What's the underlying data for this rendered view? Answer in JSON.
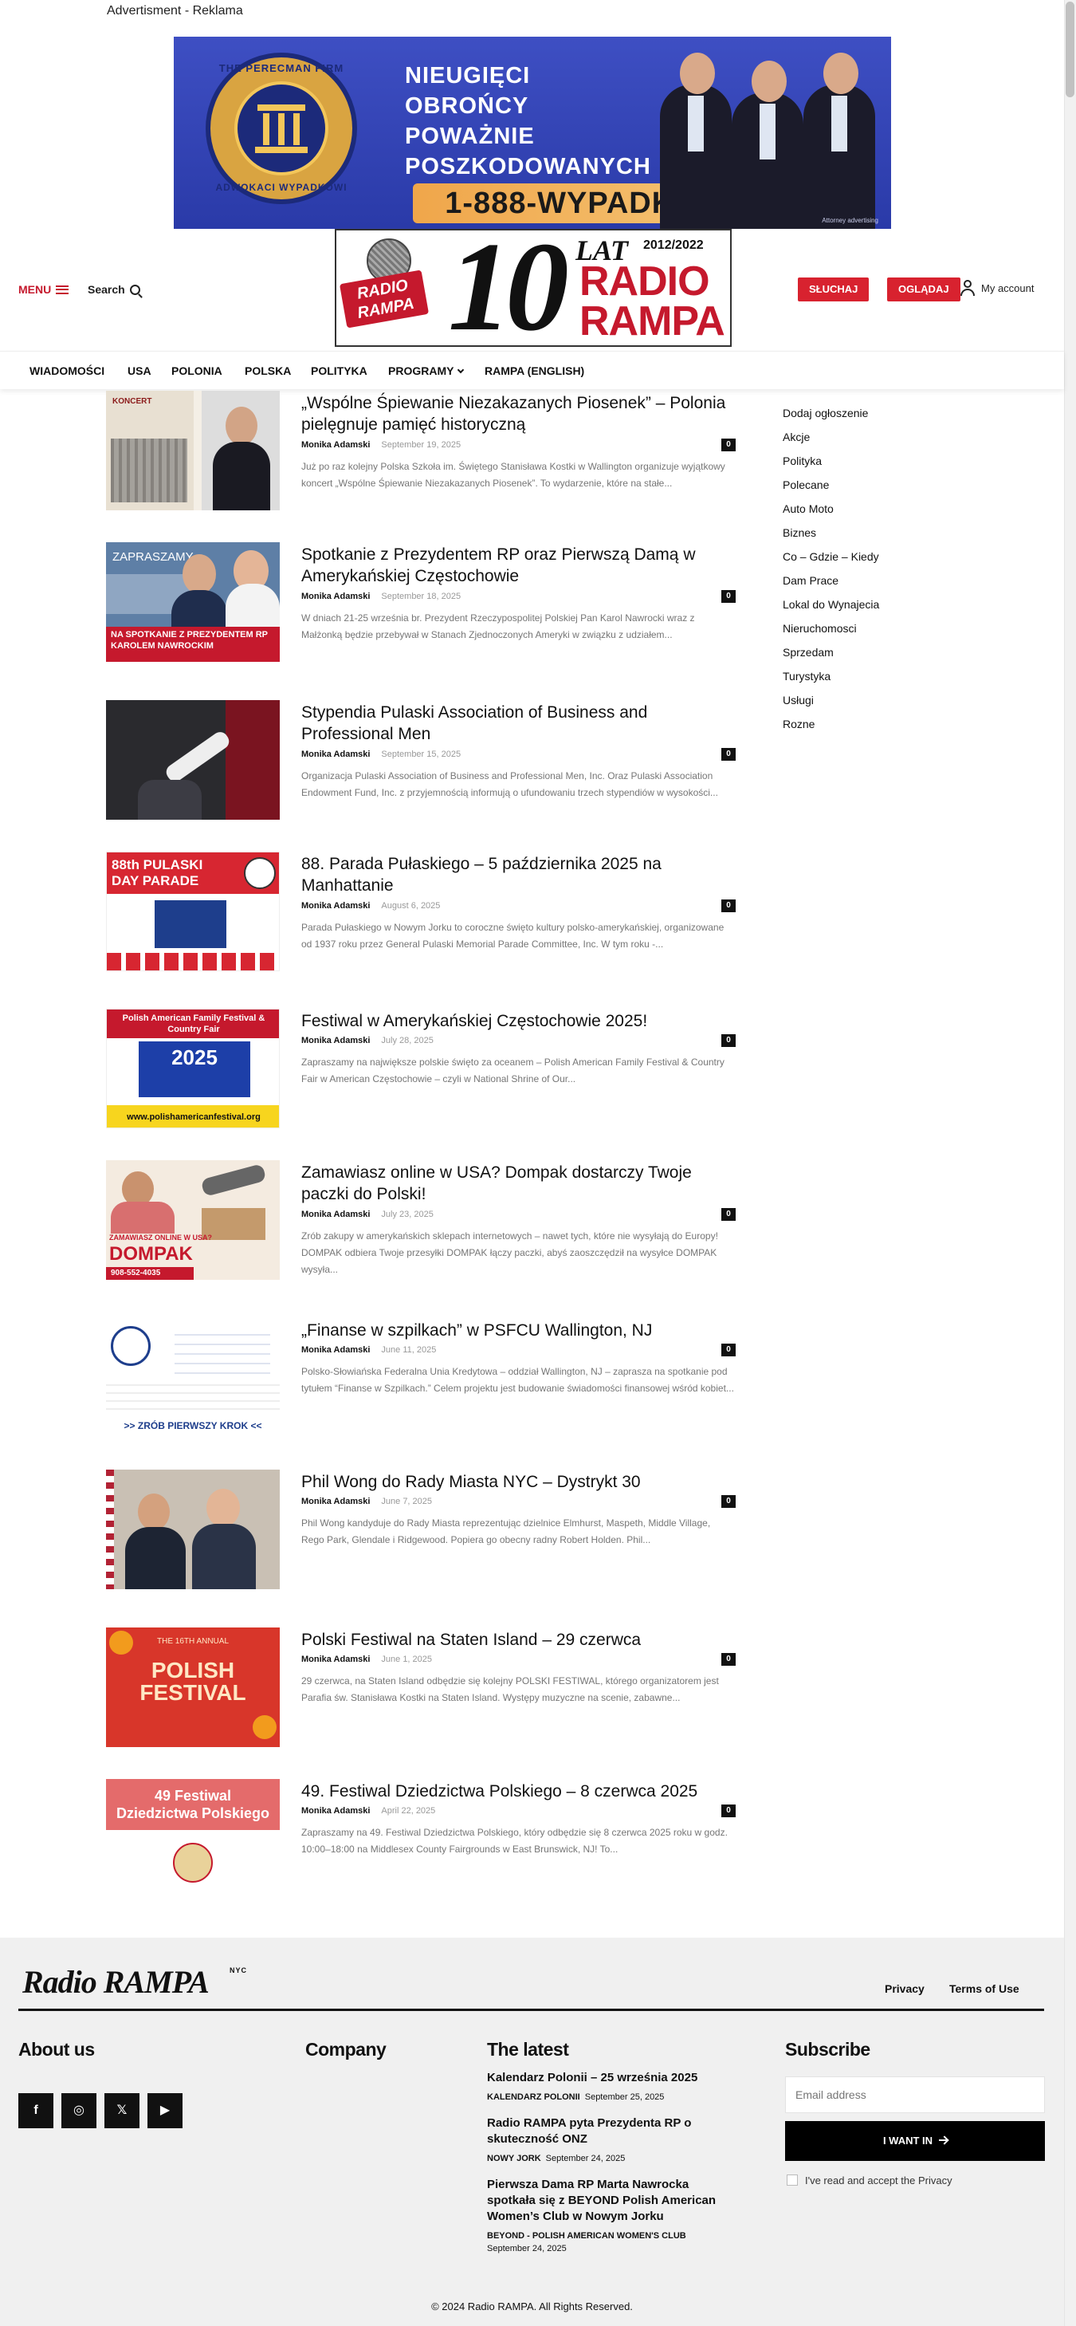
{
  "ad": {
    "label": "Advertisment - Reklama",
    "logo_top": "THE PERECMAN FIRM",
    "logo_bottom": "ADWOKACI WYPADKOWI",
    "headline": "NIEUGIĘCI OBROŃCY POWAŻNIE POSZKODOWANYCH",
    "phone": "1-888-WYPADKI",
    "disclaimer": "Attorney advertising"
  },
  "header": {
    "menu_label": "MENU",
    "search_label": "Search",
    "logo": {
      "ten": "10",
      "lat": "LAT",
      "years": "2012/2022",
      "radio": "RADIO",
      "rampa": "RAMPA",
      "mic_tag": "RADIO RAMPA"
    },
    "listen_label": "SŁUCHAJ",
    "watch_label": "OGLĄDAJ",
    "account_label": "My account"
  },
  "nav": {
    "items": [
      "WIADOMOŚCI",
      "USA",
      "POLONIA",
      "POLSKA",
      "POLITYKA",
      "PROGRAMY",
      "RAMPA (ENGLISH)"
    ]
  },
  "articles": [
    {
      "title": "„Wspólne Śpiewanie Niezakazanych Piosenek” – Polonia pielęgnuje pamięć historyczną",
      "author": "Monika Adamski",
      "date": "September 19, 2025",
      "comments": "0",
      "excerpt": "Już po raz kolejny Polska Szkoła im. Świętego Stanisława Kostki w Wallington organizuje wyjątkowy koncert „Wspólne Śpiewanie Niezakazanych Piosenek”. To wydarzenie, które na stałe...",
      "thumb_text": "KONCERT"
    },
    {
      "title": "Spotkanie z Prezydentem RP oraz Pierwszą Damą w Amerykańskiej Częstochowie",
      "author": "Monika Adamski",
      "date": "September 18, 2025",
      "comments": "0",
      "excerpt": "W dniach 21-25 września br. Prezydent Rzeczypospolitej Polskiej Pan Karol Nawrocki wraz z Małżonką będzie przebywał w Stanach Zjednoczonych Ameryki w związku z udziałem...",
      "thumb_text": "NA SPOTKANIE Z PREZYDENTEM RP KAROLEM NAWROCKIM",
      "thumb_top": "ZAPRASZAMY"
    },
    {
      "title": "Stypendia Pulaski Association of Business and Professional Men",
      "author": "Monika Adamski",
      "date": "September 15, 2025",
      "comments": "0",
      "excerpt": "Organizacja Pulaski Association of Business and Professional Men, Inc. Oraz Pulaski Association Endowment Fund, Inc. z przyjemnością informują o ufundowaniu trzech stypendiów w wysokości..."
    },
    {
      "title": "88. Parada Pułaskiego – 5 października 2025 na Manhattanie",
      "author": "Monika Adamski",
      "date": "August 6, 2025",
      "comments": "0",
      "excerpt": "Parada Pułaskiego w Nowym Jorku to coroczne święto kultury polsko-amerykańskiej, organizowane od 1937 roku przez General Pulaski Memorial Parade Committee, Inc. W tym roku -...",
      "thumb_text": "88th PULASKI DAY PARADE"
    },
    {
      "title": "Festiwal w Amerykańskiej Częstochowie 2025!",
      "author": "Monika Adamski",
      "date": "July 28, 2025",
      "comments": "0",
      "excerpt": "Zapraszamy na największe polskie święto za oceanem – Polish American Family Festival & Country Fair w American Częstochowie – czyli w National Shrine of Our...",
      "thumb_text": "Polish American Family Festival & Country Fair",
      "thumb_year": "2025",
      "thumb_url": "www.polishamericanfestival.org"
    },
    {
      "title": "Zamawiasz online w USA? Dompak dostarczy Twoje paczki do Polski!",
      "author": "Monika Adamski",
      "date": "July 23, 2025",
      "comments": "0",
      "excerpt": "Zrób zakupy w amerykańskich sklepach internetowych – nawet tych, które nie wysyłają do Europy! DOMPAK odbiera Twoje przesyłki DOMPAK łączy paczki, abyś zaoszczędził na wysyłce DOMPAK wysyła...",
      "thumb_text": "ZAMAWIASZ ONLINE W USA?",
      "thumb_brand": "DOMPAK",
      "thumb_phone": "908-552-4035"
    },
    {
      "title": "„Finanse w szpilkach” w PSFCU Wallington, NJ",
      "author": "Monika Adamski",
      "date": "June 11, 2025",
      "comments": "0",
      "excerpt": "Polsko-Słowiańska Federalna Unia Kredytowa – oddział Wallington, NJ – zaprasza na spotkanie pod tytułem “Finanse w Szpilkach.” Celem projektu jest budowanie świadomości finansowej wśród kobiet...",
      "thumb_text": ">> ZRÓB PIERWSZY KROK <<"
    },
    {
      "title": "Phil Wong do Rady Miasta NYC – Dystrykt 30",
      "author": "Monika Adamski",
      "date": "June 7, 2025",
      "comments": "0",
      "excerpt": "Phil Wong kandyduje do Rady Miasta reprezentując dzielnice Elmhurst, Maspeth, Middle Village, Rego Park, Glendale i Ridgewood. Popiera go obecny radny Robert Holden. Phil..."
    },
    {
      "title": "Polski Festiwal na Staten Island – 29 czerwca",
      "author": "Monika Adamski",
      "date": "June 1, 2025",
      "comments": "0",
      "excerpt": "29 czerwca, na Staten Island odbędzie się kolejny POLSKI FESTIWAL, którego organizatorem jest Parafia św. Stanisława Kostki na Staten Island. Występy muzyczne na scenie, zabawne...",
      "thumb_text": "POLISH FESTIVAL",
      "thumb_top": "THE 16TH ANNUAL"
    },
    {
      "title": "49. Festiwal Dziedzictwa Polskiego – 8 czerwca 2025",
      "author": "Monika Adamski",
      "date": "April 22, 2025",
      "comments": "0",
      "excerpt": "Zapraszamy na 49. Festiwal Dziedzictwa Polskiego, który odbędzie się 8 czerwca 2025 roku w godz. 10:00–18:00 na Middlesex County Fairgrounds w East Brunswick, NJ! To...",
      "thumb_text": "49 Festiwal Dziedzictwa Polskiego"
    }
  ],
  "sidebar": {
    "items": [
      "Dodaj ogłoszenie",
      "Akcje",
      "Polityka",
      "Polecane",
      "Auto Moto",
      "Biznes",
      "Co – Gdzie – Kiedy",
      "Dam Prace",
      "Lokal do Wynajecia",
      "Nieruchomosci",
      "Sprzedam",
      "Turystyka",
      "Usługi",
      "Rozne"
    ]
  },
  "footer": {
    "logo": "Radio RAMPA",
    "logo_suffix": "NYC",
    "links": [
      "Privacy",
      "Terms of Use"
    ],
    "about_heading": "About us",
    "company_heading": "Company",
    "latest_heading": "The latest",
    "subscribe_heading": "Subscribe",
    "social": [
      "f",
      "◎",
      "𝕏",
      "▶"
    ],
    "latest": [
      {
        "title": "Kalendarz Polonii – 25 września 2025",
        "category": "KALENDARZ POLONII",
        "date": "September 25, 2025"
      },
      {
        "title": "Radio RAMPA pyta Prezydenta RP o skuteczność ONZ",
        "category": "NOWY JORK",
        "date": "September 24, 2025"
      },
      {
        "title": "Pierwsza Dama RP Marta Nawrocka spotkała się z BEYOND Polish American Women’s Club w Nowym Jorku",
        "category": "BEYOND - POLISH AMERICAN WOMEN'S CLUB",
        "date": "September 24, 2025"
      }
    ],
    "email_placeholder": "Email address",
    "want_in_label": "I WANT IN",
    "privacy_label": "I've read and accept the Privacy",
    "copyright": "© 2024 Radio RAMPA. All Rights Reserved."
  }
}
